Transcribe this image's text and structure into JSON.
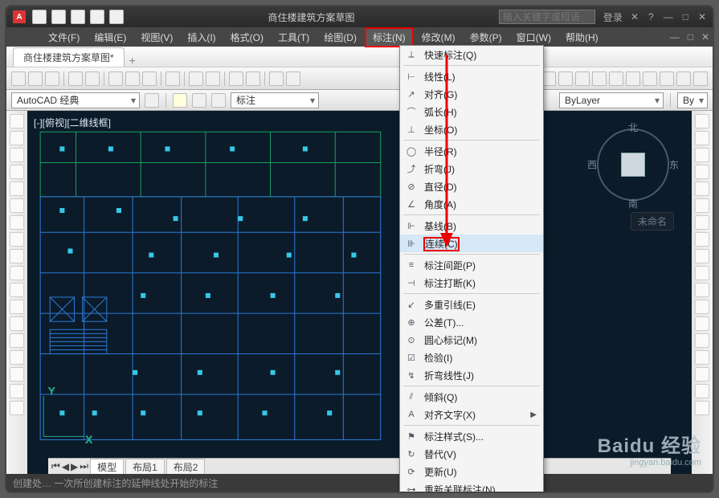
{
  "title": "商住楼建筑方案草图",
  "search_placeholder": "输入关键字或短语",
  "login_text": "登录",
  "menubar": [
    "文件(F)",
    "编辑(E)",
    "视图(V)",
    "插入(I)",
    "格式(O)",
    "工具(T)",
    "绘图(D)",
    "标注(N)",
    "修改(M)",
    "参数(P)",
    "窗口(W)",
    "帮助(H)"
  ],
  "file_tab": "商住楼建筑方案草图*",
  "workspace": "AutoCAD 经典",
  "annot_label": "标注",
  "layer_label": "ByLayer",
  "layer_suffix": "By",
  "view_label": "[-][俯视][二维线框]",
  "compass": {
    "n": "北",
    "s": "南",
    "e": "东",
    "w": "西"
  },
  "unnamed": "未命名",
  "model_tabs": [
    "模型",
    "布局1",
    "布局2"
  ],
  "statusbar_text": "创建处… 一次所创建标注的延伸线处开始的标注",
  "dropdown": {
    "items": [
      {
        "label": "快速标注(Q)",
        "glyph": "⟂"
      },
      {
        "sep": true
      },
      {
        "label": "线性(L)",
        "glyph": "⊢"
      },
      {
        "label": "对齐(G)",
        "glyph": "↗"
      },
      {
        "label": "弧长(H)",
        "glyph": "⌒"
      },
      {
        "label": "坐标(O)",
        "glyph": "⊥"
      },
      {
        "sep": true
      },
      {
        "label": "半径(R)",
        "glyph": "◯"
      },
      {
        "label": "折弯(J)",
        "glyph": "⤴"
      },
      {
        "label": "直径(D)",
        "glyph": "⊘"
      },
      {
        "label": "角度(A)",
        "glyph": "∠"
      },
      {
        "sep": true
      },
      {
        "label": "基线(B)",
        "glyph": "⊩"
      },
      {
        "label": "连续(C)",
        "glyph": "⊪",
        "hover": true,
        "highlight": true
      },
      {
        "sep": true
      },
      {
        "label": "标注间距(P)",
        "glyph": "≡"
      },
      {
        "label": "标注打断(K)",
        "glyph": "⊣"
      },
      {
        "sep": true
      },
      {
        "label": "多重引线(E)",
        "glyph": "↙"
      },
      {
        "label": "公差(T)...",
        "glyph": "⊕"
      },
      {
        "label": "圆心标记(M)",
        "glyph": "⊙"
      },
      {
        "label": "检验(I)",
        "glyph": "☑"
      },
      {
        "label": "折弯线性(J)",
        "glyph": "↯"
      },
      {
        "sep": true
      },
      {
        "label": "倾斜(Q)",
        "glyph": "⫽"
      },
      {
        "label": "对齐文字(X)",
        "glyph": "A",
        "submenu": true
      },
      {
        "sep": true
      },
      {
        "label": "标注样式(S)...",
        "glyph": "⚑"
      },
      {
        "label": "替代(V)",
        "glyph": "↻"
      },
      {
        "label": "更新(U)",
        "glyph": "⟳"
      },
      {
        "label": "重新关联标注(N)",
        "glyph": "⊶"
      }
    ]
  },
  "watermark": {
    "brand": "Baidu 经验",
    "url": "jingyan.baidu.com"
  }
}
